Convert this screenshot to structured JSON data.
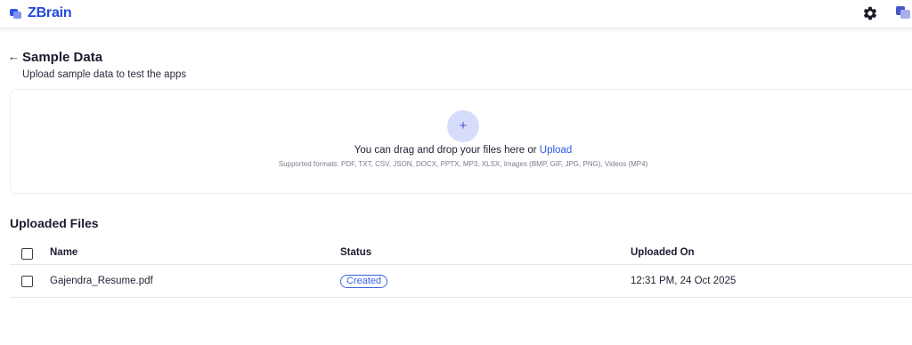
{
  "app": {
    "name": "ZBrain"
  },
  "header": {
    "settings_icon": "gear-icon",
    "avatar_icon": "user-avatar"
  },
  "page": {
    "title": "Sample Data",
    "subtitle": "Upload sample data to test the apps"
  },
  "dropzone": {
    "add_icon": "+",
    "prompt": "You can drag and drop your files here or ",
    "upload_link": "Upload",
    "formats": "Supported formats: PDF, TXT, CSV, JSON, DOCX, PPTX, MP3, XLSX, Images (BMP, GIF, JPG, PNG), Videos (MP4)"
  },
  "uploaded": {
    "title": "Uploaded Files",
    "columns": [
      "Name",
      "Status",
      "Uploaded On"
    ],
    "rows": [
      {
        "name": "Gajendra_Resume.pdf",
        "status": "Created",
        "uploaded_on": "12:31 PM, 24 Oct 2025"
      }
    ]
  },
  "colors": {
    "brand": "#2249dd",
    "link": "#2d55e0",
    "badge": "#3a62e3"
  }
}
